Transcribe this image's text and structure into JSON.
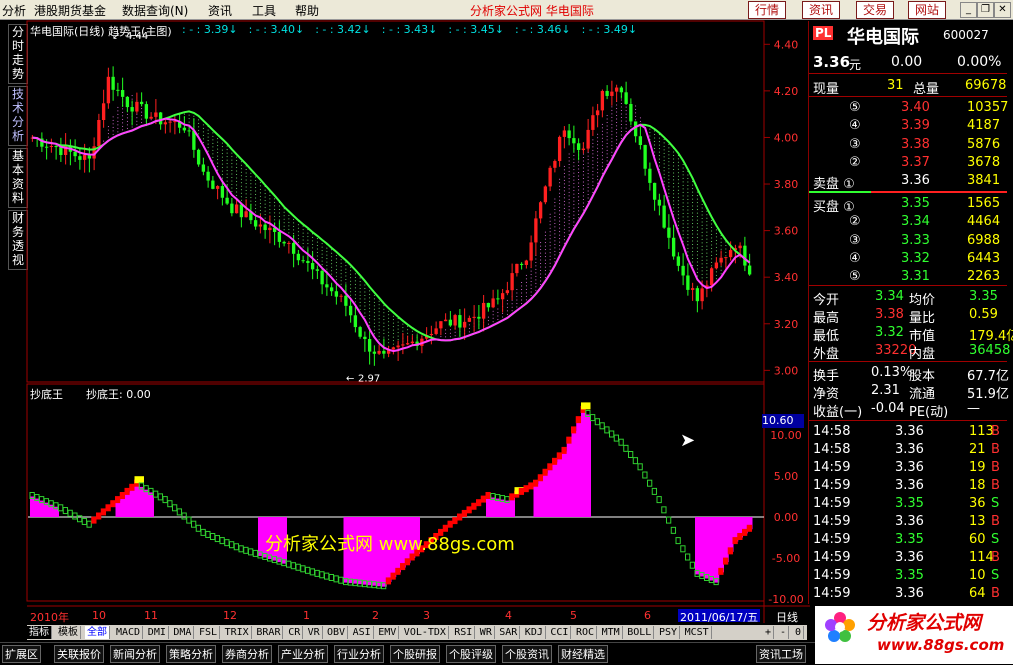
{
  "menu": {
    "items": [
      "分析",
      "港股期货基金",
      "数据查询(N)",
      "资讯",
      "工具",
      "帮助"
    ],
    "brand": "分析家公式网 华电国际",
    "buttons": [
      "行情",
      "资讯",
      "交易",
      "网站"
    ]
  },
  "left_tabs": [
    "分时走势",
    "技术分析",
    "基本资料",
    "财务透视"
  ],
  "main_chart": {
    "title": "华电国际(日线) 趋势王(主图)",
    "top_labels": [
      ": - : 3.39↓",
      ": - : 3.40↓",
      ": - : 3.42↓",
      ": - : 3.43↓",
      ": - : 3.45↓",
      ": - : 3.46↓",
      ": - : 3.49↓"
    ],
    "y_ticks": [
      "4.40",
      "4.20",
      "4.00",
      "3.80",
      "3.60",
      "3.40",
      "3.20",
      "3.00"
    ],
    "high_label": "4.44",
    "low_label": "2.97",
    "colors": {
      "up": "#ff2020",
      "down": "#20ff20",
      "ma_slow": "#40ff40",
      "ma_fast": "#ff40ff"
    }
  },
  "sub_chart": {
    "name": "抄底王",
    "label": "抄底王: 0.00",
    "y_ticks": [
      "10.00",
      "5.00",
      "0.00",
      "-5.00",
      "-10.00"
    ],
    "current_value": "10.60",
    "watermark": "分析家公式网 www.88gs.com",
    "colors": {
      "red": "#ff0000",
      "magenta": "#ff00ff",
      "green": "#30d030",
      "yellow": "#ffff00"
    }
  },
  "x_axis": {
    "labels": [
      "2010年",
      "10",
      "11",
      "12",
      "1",
      "2",
      "3",
      "4",
      "5",
      "6"
    ],
    "current_date": "2011/06/17/五",
    "period": "日线"
  },
  "chart_data": {
    "type": "candlestick",
    "title": "华电国际(日线) 趋势王(主图)",
    "ylim": [
      2.95,
      4.5
    ],
    "labels": {
      "high": 4.44,
      "low": 2.97
    },
    "sub_indicator": {
      "name": "抄底王",
      "value": 0.0,
      "ylim": [
        -10,
        10
      ],
      "current": 10.6
    }
  },
  "quote": {
    "logo": "PL",
    "name": "华电国际",
    "code": "600027",
    "price": "3.36",
    "price_unit": "元",
    "change": "0.00",
    "change_pct": "0.00%",
    "now_vol_label": "现量",
    "now_vol": "31",
    "total_vol_label": "总量",
    "total_vol": "69678",
    "asks": [
      {
        "label": "⑤",
        "price": "3.40",
        "vol": "10357"
      },
      {
        "label": "④",
        "price": "3.39",
        "vol": "4187"
      },
      {
        "label": "③",
        "price": "3.38",
        "vol": "5876"
      },
      {
        "label": "②",
        "price": "3.37",
        "vol": "3678"
      },
      {
        "label": "卖盘 ①",
        "price": "3.36",
        "vol": "3841"
      }
    ],
    "bids": [
      {
        "label": "买盘 ①",
        "price": "3.35",
        "vol": "1565"
      },
      {
        "label": "②",
        "price": "3.34",
        "vol": "4464"
      },
      {
        "label": "③",
        "price": "3.33",
        "vol": "6988"
      },
      {
        "label": "④",
        "price": "3.32",
        "vol": "6443"
      },
      {
        "label": "⑤",
        "price": "3.31",
        "vol": "2263"
      }
    ],
    "stats": [
      {
        "l1": "今开",
        "v1": "3.34",
        "l2": "均价",
        "v2": "3.35"
      },
      {
        "l1": "最高",
        "v1": "3.38",
        "l2": "量比",
        "v2": "0.59"
      },
      {
        "l1": "最低",
        "v1": "3.32",
        "l2": "市值",
        "v2": "179.4亿"
      },
      {
        "l1": "外盘",
        "v1": "33220",
        "l2": "内盘",
        "v2": "36458"
      }
    ],
    "stats2": [
      {
        "l1": "换手",
        "v1": "0.13%",
        "l2": "股本",
        "v2": "67.7亿"
      },
      {
        "l1": "净资",
        "v1": "2.31",
        "l2": "流通",
        "v2": "51.9亿"
      },
      {
        "l1": "收益(一)",
        "v1": "-0.04",
        "l2": "PE(动)",
        "v2": "—"
      }
    ],
    "ticks": [
      {
        "time": "14:58",
        "price": "3.36",
        "vol": "113",
        "side": "B"
      },
      {
        "time": "14:58",
        "price": "3.36",
        "vol": "21",
        "side": "B"
      },
      {
        "time": "14:59",
        "price": "3.36",
        "vol": "19",
        "side": "B"
      },
      {
        "time": "14:59",
        "price": "3.36",
        "vol": "18",
        "side": "B"
      },
      {
        "time": "14:59",
        "price": "3.35",
        "vol": "36",
        "side": "S"
      },
      {
        "time": "14:59",
        "price": "3.36",
        "vol": "13",
        "side": "B"
      },
      {
        "time": "14:59",
        "price": "3.35",
        "vol": "60",
        "side": "S"
      },
      {
        "time": "14:59",
        "price": "3.36",
        "vol": "114",
        "side": "B"
      },
      {
        "time": "14:59",
        "price": "3.35",
        "vol": "10",
        "side": "S"
      },
      {
        "time": "14:59",
        "price": "3.36",
        "vol": "64",
        "side": "B"
      }
    ]
  },
  "indicator_tabs": [
    "指标",
    "模板",
    "全部",
    "MACD",
    "DMI",
    "DMA",
    "FSL",
    "TRIX",
    "BRAR",
    "CR",
    "VR",
    "OBV",
    "ASI",
    "EMV",
    "VOL-TDX",
    "RSI",
    "WR",
    "SAR",
    "KDJ",
    "CCI",
    "ROC",
    "MTM",
    "BOLL",
    "PSY",
    "MCST"
  ],
  "indicator_controls": [
    "+",
    "-",
    "0"
  ],
  "bottom_tabs": [
    "扩展区",
    "关联报价",
    "新闻分析",
    "策略分析",
    "券商分析",
    "产业分析",
    "行业分析",
    "个股研报",
    "个股评级",
    "个股资讯",
    "财经精选",
    "资讯工场"
  ],
  "footer_logo": {
    "title": "分析家公式网",
    "url": "www.88gs.com"
  }
}
